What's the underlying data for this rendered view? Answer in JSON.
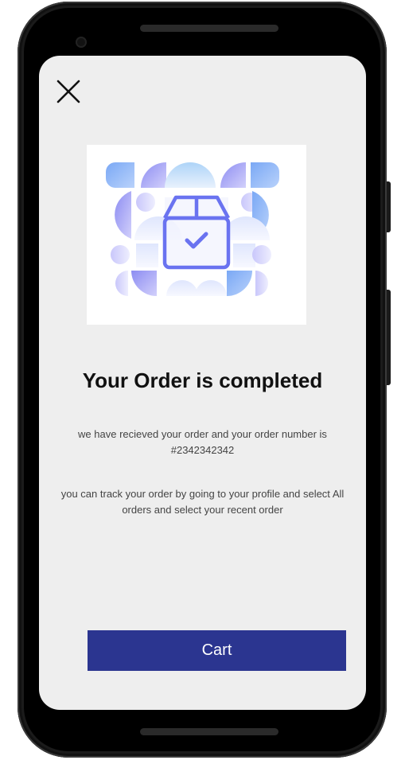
{
  "screen": {
    "close_icon": "close-icon",
    "illustration_icon": "package-check-icon",
    "title": "Your Order is completed",
    "message_order": "we have recieved your order and your order number is #2342342342",
    "message_track": "you can track your order by going to your profile and select All orders and select your recent order",
    "cart_button_label": "Cart"
  },
  "colors": {
    "screen_background": "#eeeeee",
    "button_background": "#2b3590",
    "button_text": "#ffffff",
    "illustration_accent": "#6a73f0"
  }
}
